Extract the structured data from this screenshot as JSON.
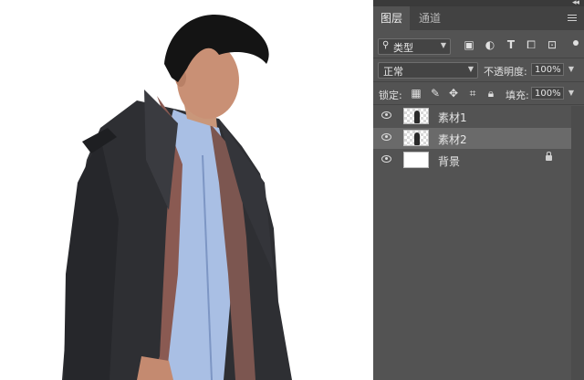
{
  "canvas": {
    "subject": "person-in-coat-cutout"
  },
  "panel": {
    "tabs": [
      {
        "label": "图层"
      },
      {
        "label": "通道"
      }
    ],
    "filter": {
      "kind_label": "类型"
    },
    "blend": {
      "mode": "正常",
      "opacity_label": "不透明度:",
      "opacity_value": "100%"
    },
    "lock": {
      "label": "锁定:",
      "fill_label": "填充:",
      "fill_value": "100%"
    },
    "layers": [
      {
        "name": "素材1",
        "selected": false,
        "thumb": "transparent-figure"
      },
      {
        "name": "素材2",
        "selected": true,
        "thumb": "transparent-figure"
      },
      {
        "name": "背景",
        "selected": false,
        "thumb": "white",
        "locked": true
      }
    ]
  }
}
